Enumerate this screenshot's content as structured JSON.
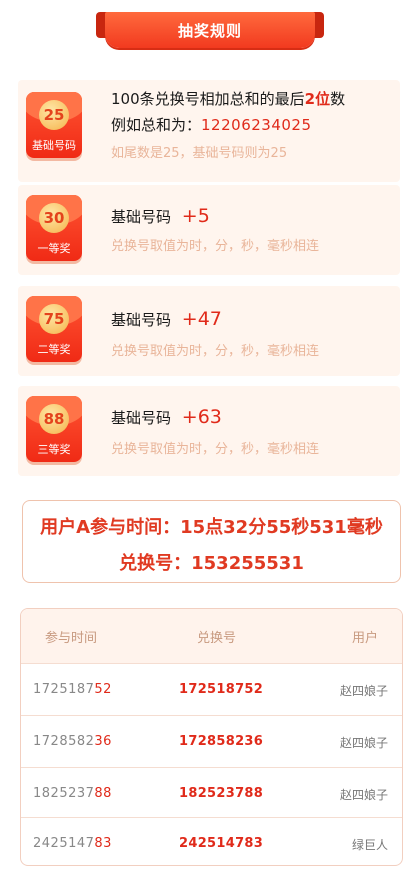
{
  "header": {
    "title": "抽奖规则"
  },
  "cards": [
    {
      "badge_number": "25",
      "badge_label": "基础号码",
      "line1_prefix": "100条兑换号相加总和的最后",
      "line1_highlight": "2位",
      "line1_suffix": "数",
      "line2_prefix": "例如总和为：",
      "line2_value": "12206234025",
      "note": "如尾数是25，基础号码则为25"
    },
    {
      "badge_number": "30",
      "badge_label": "一等奖",
      "label": "基础号码",
      "plus": "+5",
      "note": "兑换号取值为时，分，秒，毫秒相连"
    },
    {
      "badge_number": "75",
      "badge_label": "二等奖",
      "label": "基础号码",
      "plus": "+47",
      "note": "兑换号取值为时，分，秒，毫秒相连"
    },
    {
      "badge_number": "88",
      "badge_label": "三等奖",
      "label": "基础号码",
      "plus": "+63",
      "note": "兑换号取值为时，分，秒，毫秒相连"
    }
  ],
  "info": {
    "line1": "用户A参与时间：15点32分55秒531毫秒",
    "line2": "兑换号：153255531"
  },
  "table": {
    "headers": [
      "参与时间",
      "兑换号",
      "用户"
    ],
    "rows": [
      {
        "time_prefix": "1725187",
        "time_suffix": "52",
        "code": "172518752",
        "user": "赵四娘子"
      },
      {
        "time_prefix": "1728582",
        "time_suffix": "36",
        "code": "172858236",
        "user": "赵四娘子"
      },
      {
        "time_prefix": "1825237",
        "time_suffix": "88",
        "code": "182523788",
        "user": "赵四娘子"
      },
      {
        "time_prefix": "2425147",
        "time_suffix": "83",
        "code": "242514783",
        "user": "绿巨人"
      }
    ]
  },
  "colors": {
    "accent": "#e02a1a",
    "card_bg": "#fff5ee",
    "note": "#e9b59a"
  }
}
